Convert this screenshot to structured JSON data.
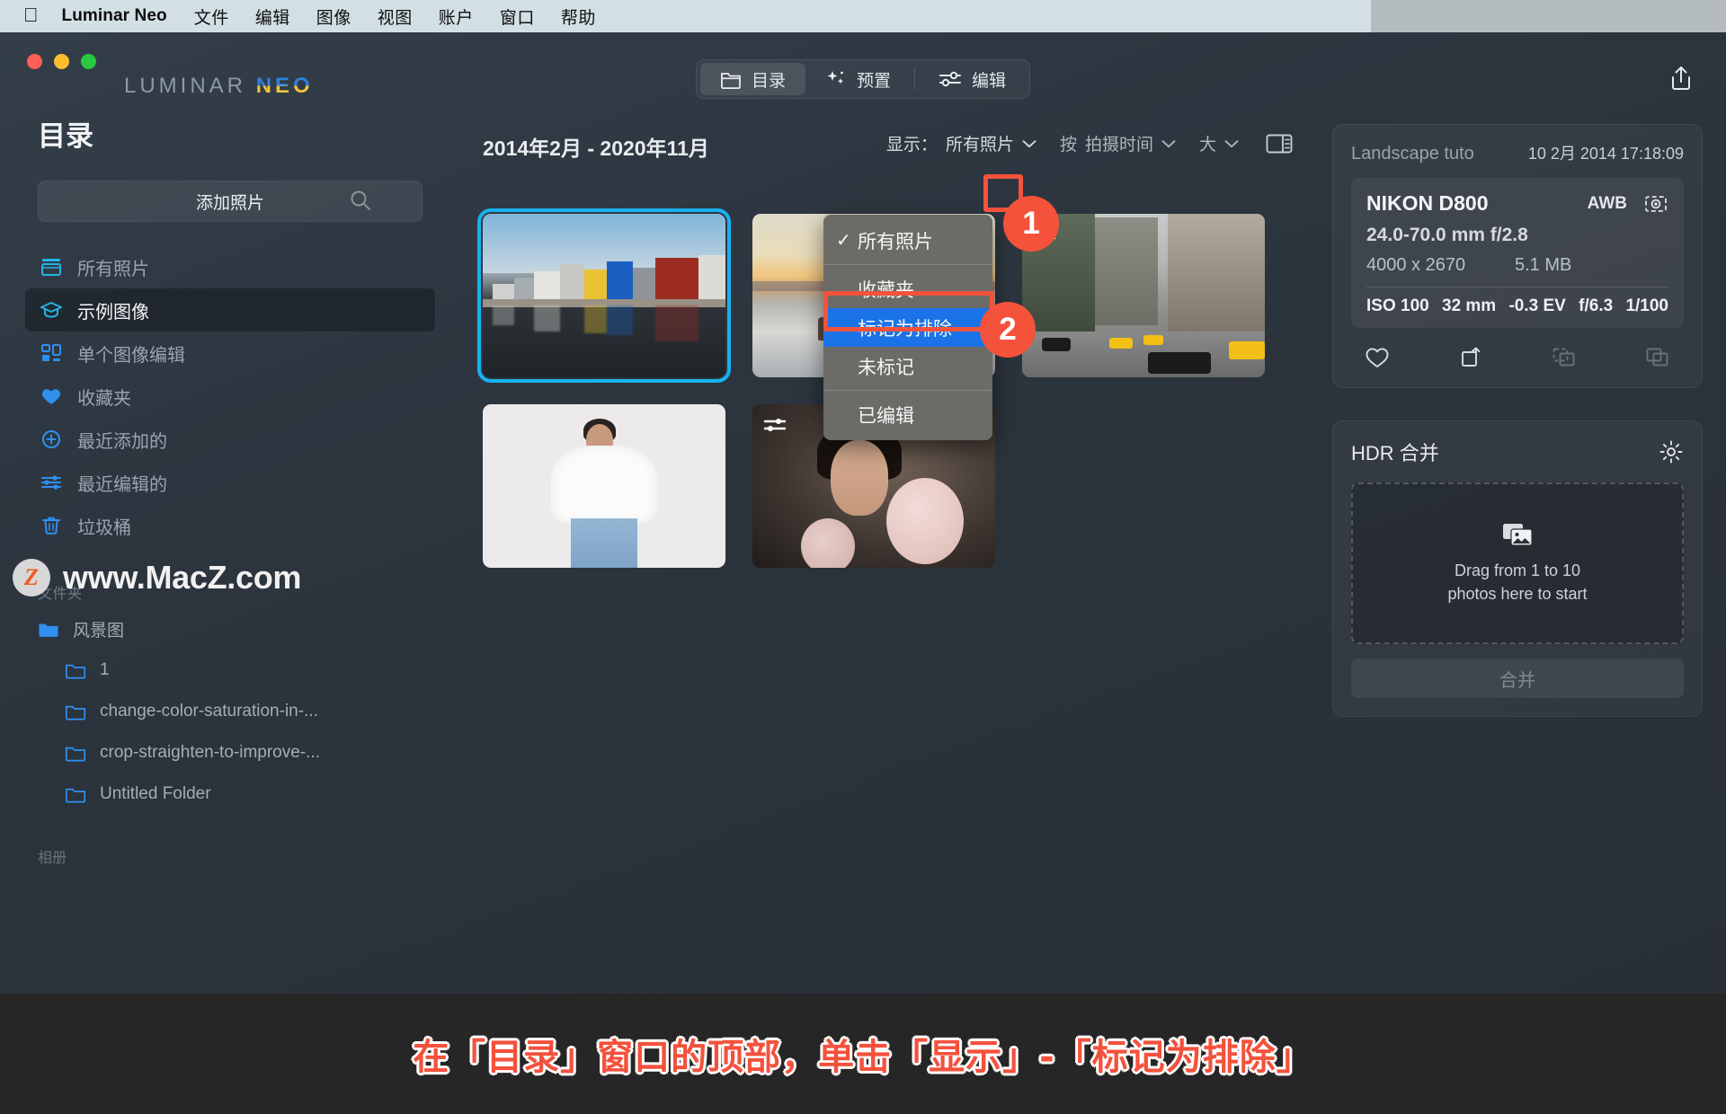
{
  "menubar": {
    "apple_icon": "apple-icon",
    "app_name": "Luminar Neo",
    "items": [
      "文件",
      "编辑",
      "图像",
      "视图",
      "账户",
      "窗口",
      "帮助"
    ]
  },
  "topbar": {
    "brand_prefix": "LUMINAR",
    "brand_suffix": "NEO",
    "tabs": [
      {
        "label": "目录",
        "icon": "folder-icon",
        "active": true
      },
      {
        "label": "预置",
        "icon": "sparkle-icon",
        "active": false
      },
      {
        "label": "编辑",
        "icon": "sliders-icon",
        "active": false
      }
    ],
    "share_icon": "share-icon"
  },
  "sidebar": {
    "title": "目录",
    "search_icon": "search-icon",
    "add_photos_label": "添加照片",
    "items": [
      {
        "label": "所有照片",
        "icon": "all-photos-icon",
        "active": false
      },
      {
        "label": "示例图像",
        "icon": "graduation-cap-icon",
        "active": true
      },
      {
        "label": "单个图像编辑",
        "icon": "grid-icon",
        "active": false
      },
      {
        "label": "收藏夹",
        "icon": "heart-icon",
        "active": false
      },
      {
        "label": "最近添加的",
        "icon": "plus-circle-icon",
        "active": false
      },
      {
        "label": "最近编辑的",
        "icon": "sliders-icon",
        "active": false
      },
      {
        "label": "垃圾桶",
        "icon": "trash-icon",
        "active": false
      }
    ],
    "folders_section_label": "文件夹",
    "folders": [
      {
        "label": "风景图",
        "icon": "folder-open-icon",
        "level": 0
      },
      {
        "label": "1",
        "icon": "folder-icon",
        "level": 1
      },
      {
        "label": "change-color-saturation-in-...",
        "icon": "folder-icon",
        "level": 1
      },
      {
        "label": "crop-straighten-to-improve-...",
        "icon": "folder-icon",
        "level": 1
      },
      {
        "label": "Untitled Folder",
        "icon": "folder-icon",
        "level": 1
      }
    ],
    "albums_section_label": "相册"
  },
  "watermark": {
    "badge_letter": "Z",
    "text": "www.MacZ.com"
  },
  "filterbar": {
    "date_range": "2014年2月 - 2020年11月",
    "show_label": "显示：",
    "show_value": "所有照片",
    "sort_prefix": "按",
    "sort_value": "拍摄时间",
    "size_value": "大",
    "panel_toggle_icon": "panel-toggle-icon",
    "chevron_icon": "chevron-down-icon"
  },
  "dropdown": {
    "items": [
      {
        "label": "所有照片",
        "checked": true,
        "selected": false
      },
      {
        "label": "收藏夹",
        "checked": false,
        "selected": false
      },
      {
        "label": "标记为排除",
        "checked": false,
        "selected": true
      },
      {
        "label": "未标记",
        "checked": false,
        "selected": false
      },
      {
        "label": "已编辑",
        "checked": false,
        "selected": false
      }
    ],
    "check_glyph": "✓"
  },
  "annotations": [
    {
      "number": "1",
      "target": "show-filter-chevron"
    },
    {
      "number": "2",
      "target": "dropdown-item-mark-rejected"
    }
  ],
  "gallery": {
    "thumbnails": [
      {
        "name": "colorful-houses-reflection",
        "selected": true,
        "edited": false
      },
      {
        "name": "desert-sunset-figure",
        "selected": false,
        "edited": false
      },
      {
        "name": "nyc-street-taxis",
        "selected": false,
        "edited": true
      },
      {
        "name": "woman-white-blouse-jeans",
        "selected": false,
        "edited": false
      },
      {
        "name": "woman-pink-tulle-portrait",
        "selected": false,
        "edited": true
      }
    ]
  },
  "exif": {
    "title": "Landscape tuto",
    "date": "10 2月 2014 17:18:09",
    "camera": "NIKON D800",
    "white_balance": "AWB",
    "wb_icon": "aperture-icon",
    "lens": "24.0-70.0 mm f/2.8",
    "dimensions": "4000 x 2670",
    "filesize": "5.1 MB",
    "stats": [
      "ISO 100",
      "32 mm",
      "-0.3 EV",
      "f/6.3",
      "1/100"
    ],
    "actions": [
      {
        "icon": "heart-icon",
        "name": "favorite-action",
        "dim": false
      },
      {
        "icon": "rotate-icon",
        "name": "rotate-action",
        "dim": false
      },
      {
        "icon": "copy-dashed-icon",
        "name": "reject-action",
        "dim": true
      },
      {
        "icon": "copy-icon",
        "name": "duplicate-action",
        "dim": true
      }
    ]
  },
  "hdr": {
    "title": "HDR 合并",
    "gear_icon": "gear-icon",
    "dropzone_icon": "photos-stack-icon",
    "dropzone_line1": "Drag from 1 to 10",
    "dropzone_line2": "photos here to start",
    "merge_label": "合并"
  },
  "caption": {
    "text": "在「目录」窗口的顶部，单击「显示」-「标记为排除」"
  },
  "colors": {
    "accent_blue": "#1a74e8",
    "selection_cyan": "#17b2f0",
    "annotation_red": "#f5523b",
    "icon_blue": "#2f90f0"
  }
}
